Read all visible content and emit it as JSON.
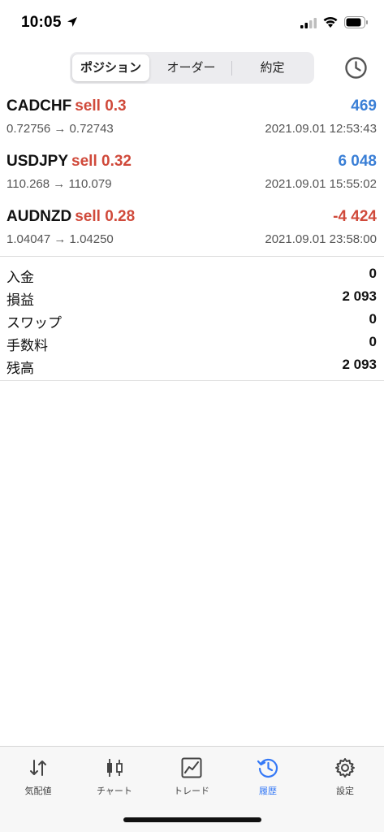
{
  "status_bar": {
    "time": "10:05",
    "icons": [
      "location-arrow-icon",
      "cellular-signal-icon",
      "wifi-icon",
      "battery-icon"
    ]
  },
  "segmented_control": {
    "tabs": [
      {
        "label": "ポジション",
        "active": true
      },
      {
        "label": "オーダー",
        "active": false
      },
      {
        "label": "約定",
        "active": false
      }
    ],
    "history_icon": "clock-icon"
  },
  "colors": {
    "sell": "#d04a3b",
    "profit_positive": "#3a7fd6",
    "profit_negative": "#d04a3b",
    "active_tab": "#3478f6"
  },
  "positions": [
    {
      "symbol": "CADCHF",
      "side": "sell 0.3",
      "profit": "469",
      "profit_sign": "positive",
      "prices": "0.72756 → 0.72743",
      "time": "2021.09.01 12:53:43"
    },
    {
      "symbol": "USDJPY",
      "side": "sell 0.32",
      "profit": "6 048",
      "profit_sign": "positive",
      "prices": "110.268 → 110.079",
      "time": "2021.09.01 15:55:02"
    },
    {
      "symbol": "AUDNZD",
      "side": "sell 0.28",
      "profit": "-4 424",
      "profit_sign": "negative",
      "prices": "1.04047 → 1.04250",
      "time": "2021.09.01 23:58:00"
    }
  ],
  "summary": [
    {
      "label": "入金",
      "value": "0"
    },
    {
      "label": "損益",
      "value": "2 093"
    },
    {
      "label": "スワップ",
      "value": "0"
    },
    {
      "label": "手数料",
      "value": "0"
    },
    {
      "label": "残高",
      "value": "2 093"
    }
  ],
  "tab_bar": {
    "tabs": [
      {
        "label": "気配値",
        "icon": "quotes-arrows-icon",
        "active": false
      },
      {
        "label": "チャート",
        "icon": "candlestick-chart-icon",
        "active": false
      },
      {
        "label": "トレード",
        "icon": "trade-chart-icon",
        "active": false
      },
      {
        "label": "履歴",
        "icon": "history-clock-icon",
        "active": true
      },
      {
        "label": "設定",
        "icon": "gear-icon",
        "active": false
      }
    ]
  }
}
